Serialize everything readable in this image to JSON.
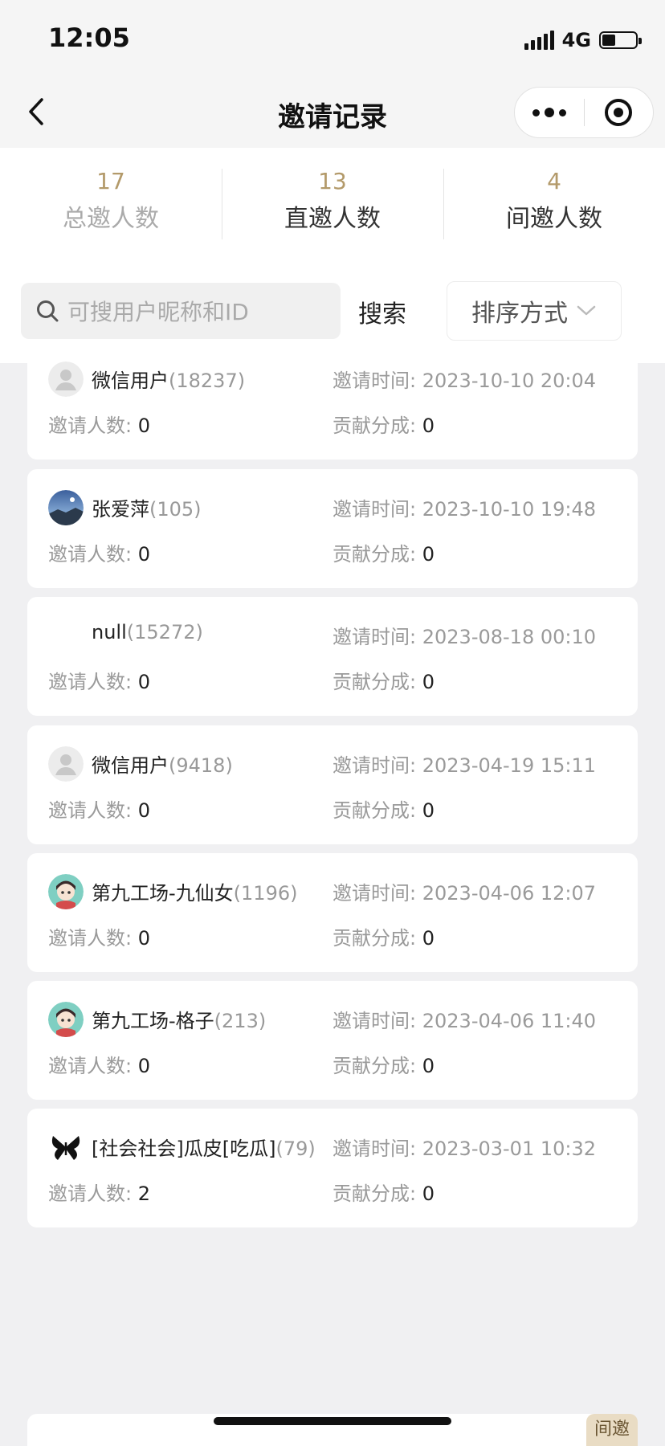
{
  "status_bar": {
    "time": "12:05",
    "network": "4G"
  },
  "nav": {
    "title": "邀请记录"
  },
  "stats": [
    {
      "num": "17",
      "label": "总邀人数"
    },
    {
      "num": "13",
      "label": "直邀人数"
    },
    {
      "num": "4",
      "label": "间邀人数"
    }
  ],
  "search": {
    "placeholder": "可搜用户昵称和ID",
    "button": "搜索",
    "sort_label": "排序方式"
  },
  "labels": {
    "invite_time": "邀请时间:",
    "invite_count": "邀请人数:",
    "contribution": "贡献分成:"
  },
  "records": [
    {
      "name": "微信用户",
      "uid": "(18237)",
      "time": "2023-10-10 20:04",
      "count": "0",
      "share": "0",
      "avatar": "default-avatar-icon"
    },
    {
      "name": "张爱萍",
      "uid": "(105)",
      "time": "2023-10-10 19:48",
      "count": "0",
      "share": "0",
      "avatar": "photo-avatar"
    },
    {
      "name": "null",
      "uid": "(15272)",
      "time": "2023-08-18 00:10",
      "count": "0",
      "share": "0",
      "avatar": "none"
    },
    {
      "name": "微信用户",
      "uid": "(9418)",
      "time": "2023-04-19 15:11",
      "count": "0",
      "share": "0",
      "avatar": "default-avatar-icon"
    },
    {
      "name": "第九工场-九仙女",
      "uid": "(1196)",
      "time": "2023-04-06 12:07",
      "count": "0",
      "share": "0",
      "avatar": "cartoon-avatar"
    },
    {
      "name": "第九工场-格子",
      "uid": "(213)",
      "time": "2023-04-06 11:40",
      "count": "0",
      "share": "0",
      "avatar": "cartoon-avatar"
    },
    {
      "name": "[社会社会]瓜皮[吃瓜]",
      "uid": "(79)",
      "time": "2023-03-01 10:32",
      "count": "2",
      "share": "0",
      "avatar": "butterfly-avatar"
    }
  ],
  "next_badge": "间邀"
}
